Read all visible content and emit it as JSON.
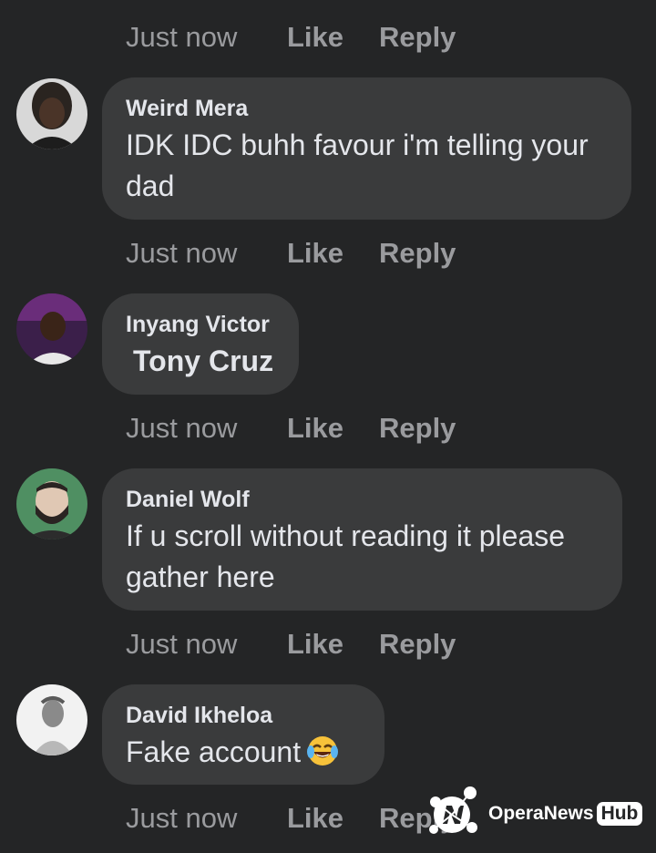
{
  "actions": {
    "time": "Just now",
    "like": "Like",
    "reply": "Reply"
  },
  "comments": [
    {
      "author": "Weird Mera",
      "text_line1": "IDK IDC buhh favour i'm telling your",
      "text_line2": "dad"
    },
    {
      "author": "Inyang Victor",
      "text_line1": "Tony Cruz"
    },
    {
      "author": "Daniel Wolf",
      "text_line1": "If u scroll without reading it please",
      "text_line2": "gather here"
    },
    {
      "author": "David Ikheloa",
      "text_line1": "Fake account",
      "emoji": "face-with-tears-of-joy"
    }
  ],
  "watermark": {
    "brand": "OperaNews",
    "hub": "Hub"
  },
  "colors": {
    "background": "#242526",
    "bubble": "#3a3b3c",
    "text": "#e4e6eb",
    "muted": "#9a9b9e"
  }
}
